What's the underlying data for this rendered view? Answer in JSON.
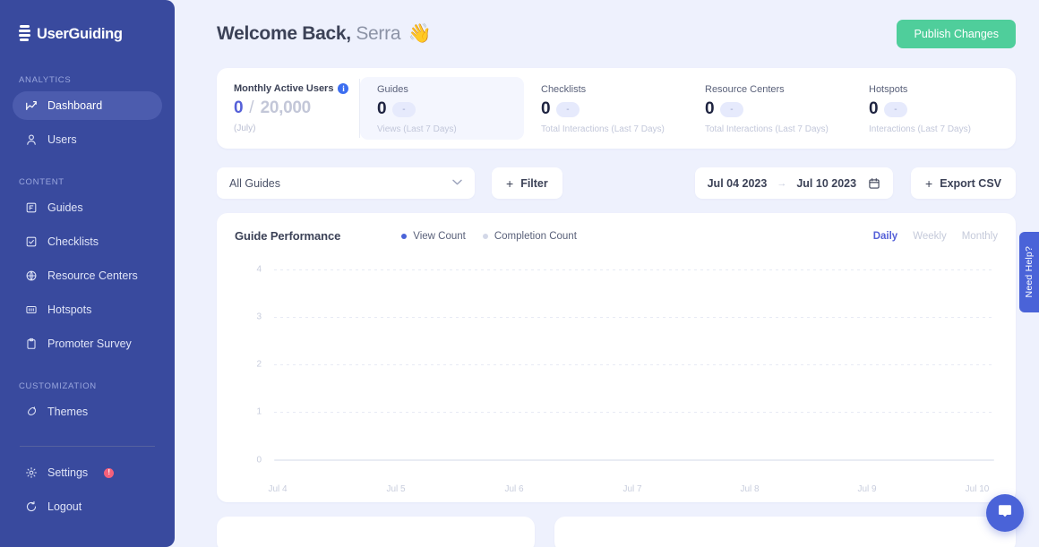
{
  "brand": {
    "name": "UserGuiding",
    "logo_icon": "userguiding-logo-icon"
  },
  "sidebar": {
    "sections": [
      {
        "label": "ANALYTICS",
        "items": [
          {
            "label": "Dashboard",
            "icon": "chart-line-icon",
            "active": true
          },
          {
            "label": "Users",
            "icon": "user-icon",
            "active": false
          }
        ]
      },
      {
        "label": "CONTENT",
        "items": [
          {
            "label": "Guides",
            "icon": "guides-icon",
            "active": false
          },
          {
            "label": "Checklists",
            "icon": "checklist-icon",
            "active": false
          },
          {
            "label": "Resource Centers",
            "icon": "resource-center-icon",
            "active": false
          },
          {
            "label": "Hotspots",
            "icon": "hotspot-icon",
            "active": false
          },
          {
            "label": "Promoter Survey",
            "icon": "clipboard-icon",
            "active": false
          }
        ]
      },
      {
        "label": "CUSTOMIZATION",
        "items": [
          {
            "label": "Themes",
            "icon": "themes-icon",
            "active": false
          }
        ]
      }
    ],
    "bottom": [
      {
        "label": "Settings",
        "icon": "gear-icon",
        "badge": "!"
      },
      {
        "label": "Logout",
        "icon": "logout-icon",
        "badge": ""
      }
    ]
  },
  "header": {
    "greeting": "Welcome Back,",
    "user_name": "Serra",
    "wave_emoji": "👋",
    "publish_label": "Publish Changes"
  },
  "stats": {
    "mau": {
      "title": "Monthly Active Users",
      "info_icon": "info-icon",
      "value": "0",
      "separator": "/",
      "total": "20,000",
      "sub": "(July)"
    },
    "cards": [
      {
        "title": "Guides",
        "value": "0",
        "chip": "-",
        "sub": "Views (Last 7 Days)",
        "shaded": true
      },
      {
        "title": "Checklists",
        "value": "0",
        "chip": "-",
        "sub": "Total Interactions (Last 7 Days)",
        "shaded": false
      },
      {
        "title": "Resource Centers",
        "value": "0",
        "chip": "-",
        "sub": "Total Interactions (Last 7 Days)",
        "shaded": false
      },
      {
        "title": "Hotspots",
        "value": "0",
        "chip": "-",
        "sub": "Interactions (Last 7 Days)",
        "shaded": false
      }
    ]
  },
  "toolbar": {
    "guide_select_value": "All Guides",
    "chevron_icon": "chevron-down-icon",
    "filter_label": "Filter",
    "filter_plus": "+",
    "date_start": "Jul 04 2023",
    "date_arrow": "→",
    "date_end": "Jul 10 2023",
    "calendar_icon": "calendar-icon",
    "export_label": "Export CSV",
    "export_plus": "+"
  },
  "chart_data": {
    "type": "line",
    "title": "Guide Performance",
    "xlabel": "",
    "ylabel": "",
    "grid": true,
    "legend_position": "top-center",
    "x": [
      "Jul 4",
      "Jul 5",
      "Jul 6",
      "Jul 7",
      "Jul 8",
      "Jul 9",
      "Jul 10"
    ],
    "yticks": [
      "4",
      "3",
      "2",
      "1",
      "0"
    ],
    "ylim": [
      0,
      4
    ],
    "series": [
      {
        "name": "View Count",
        "color": "#4a63d8",
        "values": [
          0,
          0,
          0,
          0,
          0,
          0,
          0
        ]
      },
      {
        "name": "Completion Count",
        "color": "#d3d8e8",
        "values": [
          0,
          0,
          0,
          0,
          0,
          0,
          0
        ]
      }
    ],
    "granularity_options": [
      "Daily",
      "Weekly",
      "Monthly"
    ],
    "granularity_selected": "Daily"
  },
  "floating": {
    "need_help_label": "Need Help?",
    "chat_icon": "chat-bubble-icon"
  },
  "colors": {
    "brand_blue": "#394a9e",
    "accent_blue": "#5560d8",
    "publish_green": "#4fce9b",
    "badge_red": "#f4607b",
    "page_bg": "#eef1fd"
  }
}
